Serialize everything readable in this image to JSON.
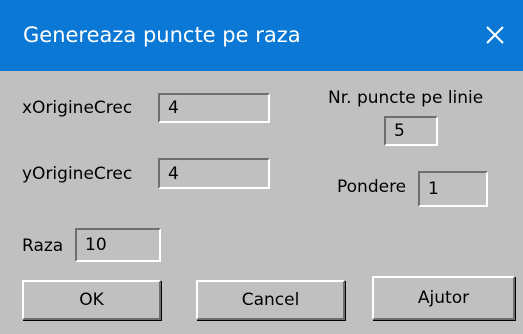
{
  "window": {
    "title": "Genereaza puncte pe raza",
    "close_glyph": "✕",
    "titlebar_color": "#0a78d4",
    "background_color": "#c0c0c0"
  },
  "fields": {
    "x_origin": {
      "label": "xOrigineCrec",
      "value": "4"
    },
    "y_origin": {
      "label": "yOrigineCrec",
      "value": "4"
    },
    "radius": {
      "label": "Raza",
      "value": "10"
    },
    "points_per_line": {
      "label": "Nr. puncte pe linie",
      "value": "5"
    },
    "weight": {
      "label": "Pondere",
      "value": "1"
    }
  },
  "buttons": {
    "ok": "OK",
    "cancel": "Cancel",
    "help": "Ajutor"
  }
}
